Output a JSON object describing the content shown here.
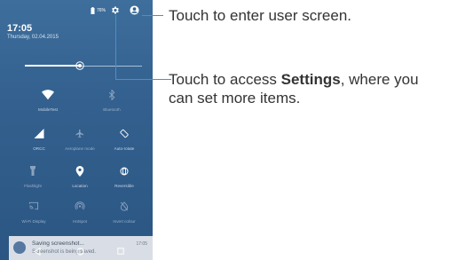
{
  "status": {
    "battery": "76%"
  },
  "clock": {
    "time": "17:05",
    "date": "Thursday, 02.04.2015"
  },
  "tiles": [
    {
      "label": "MobileTest",
      "icon": "wifi-icon"
    },
    {
      "label": "Bluetooth",
      "icon": "bluetooth-icon"
    },
    {
      "label": "ORCC",
      "icon": "signal-icon"
    },
    {
      "label": "Aeroplane mode",
      "icon": "airplane-icon"
    },
    {
      "label": "Auto-rotate",
      "icon": "rotate-icon"
    },
    {
      "label": "Flashlight",
      "icon": "flashlight-icon"
    },
    {
      "label": "Location",
      "icon": "location-icon"
    },
    {
      "label": "Reversible",
      "icon": "reversible-icon"
    },
    {
      "label": "Wi-Fi Display",
      "icon": "cast-icon"
    },
    {
      "label": "Hotspot",
      "icon": "hotspot-icon"
    },
    {
      "label": "Invert colour",
      "icon": "invert-icon"
    }
  ],
  "brightness": {
    "level": 0.47
  },
  "notification": {
    "title": "Saving screenshot...",
    "subtitle": "Screenshot is being saved.",
    "time": "17:05"
  },
  "callouts": {
    "user": "Touch to enter user screen.",
    "settings_prefix": "Touch to access ",
    "settings_bold": "Settings",
    "settings_suffix": ", where you",
    "settings_line2": "can set more items."
  },
  "colors": {
    "panel": "#33608e",
    "accent": "#4a8fcb"
  }
}
